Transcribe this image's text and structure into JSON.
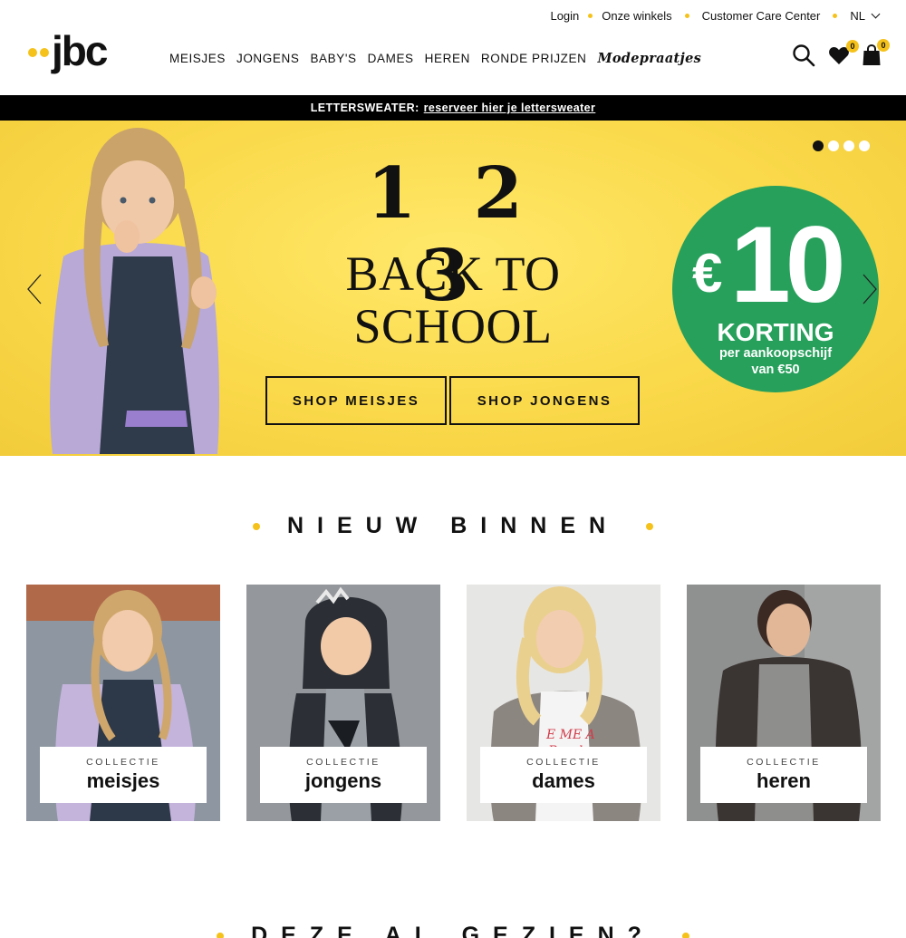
{
  "utility_nav": {
    "login": "Login",
    "stores": "Onze winkels",
    "customer_care": "Customer Care Center",
    "language": "NL"
  },
  "brand": {
    "name": "jbc",
    "accent_color": "#f5c21b"
  },
  "main_nav": {
    "items": [
      "MEISJES",
      "JONGENS",
      "BABY'S",
      "DAMES",
      "HEREN",
      "RONDE PRIJZEN",
      "Modepraatjes"
    ]
  },
  "header_icons": {
    "search": "search-icon",
    "wishlist": "heart-icon",
    "wishlist_count": "0",
    "cart": "shopping-bag-icon",
    "cart_count": "0"
  },
  "announcement": {
    "label": "LETTERSWEATER:",
    "link": "reserveer hier je lettersweater"
  },
  "hero": {
    "numbers": "1 2 3",
    "title_line1": "BACK TO",
    "title_line2": "SCHOOL",
    "cta_girls": "SHOP MEISJES",
    "cta_boys": "SHOP JONGENS",
    "promo_currency": "€",
    "promo_amount": "10",
    "promo_label": "KORTING",
    "promo_sub1": "per aankoopschijf",
    "promo_sub2": "van €50",
    "slides_total": 4,
    "active_slide": 1,
    "colors": {
      "background": "#fad94a",
      "promo": "#26a05b"
    }
  },
  "new_in": {
    "title": "NIEUW BINNEN",
    "cards": [
      {
        "kicker": "COLLECTIE",
        "label": "meisjes"
      },
      {
        "kicker": "COLLECTIE",
        "label": "jongens"
      },
      {
        "kicker": "COLLECTIE",
        "label": "dames"
      },
      {
        "kicker": "COLLECTIE",
        "label": "heren"
      }
    ]
  },
  "seen": {
    "title": "DEZE AL GEZIEN?"
  }
}
